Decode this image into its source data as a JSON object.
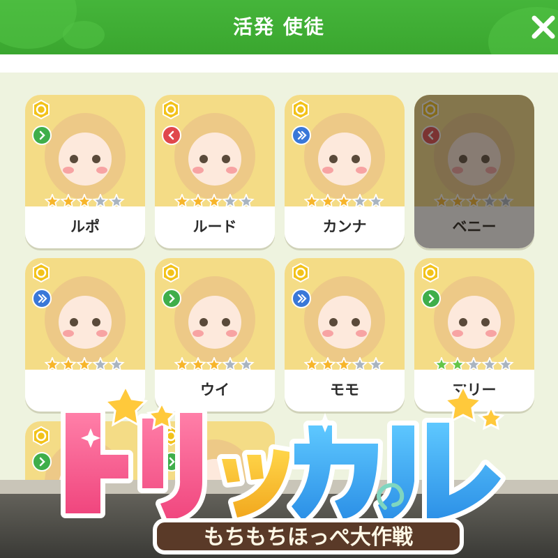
{
  "header": {
    "title": "活発 使徒",
    "close_icon": "close-icon",
    "bg_color": "#3fae34"
  },
  "characters": [
    {
      "name": "ルポ",
      "stars": 3,
      "max_stars": 5,
      "star_color": "gold",
      "direction": "forward",
      "direction_color": "#3fae4a",
      "dimmed": false
    },
    {
      "name": "ルード",
      "stars": 3,
      "max_stars": 5,
      "star_color": "gold",
      "direction": "back",
      "direction_color": "#e0474c",
      "dimmed": false
    },
    {
      "name": "カンナ",
      "stars": 3,
      "max_stars": 5,
      "star_color": "gold",
      "direction": "double",
      "direction_color": "#3a78d8",
      "dimmed": false
    },
    {
      "name": "ベニー",
      "stars": 3,
      "max_stars": 5,
      "star_color": "gold",
      "direction": "back",
      "direction_color": "#e0474c",
      "dimmed": true
    },
    {
      "name": "",
      "stars": 3,
      "max_stars": 5,
      "star_color": "gold",
      "direction": "double",
      "direction_color": "#3a78d8",
      "dimmed": false
    },
    {
      "name": "ウイ",
      "stars": 3,
      "max_stars": 5,
      "star_color": "gold",
      "direction": "forward",
      "direction_color": "#3fae4a",
      "dimmed": false
    },
    {
      "name": "モモ",
      "stars": 3,
      "max_stars": 5,
      "star_color": "gold",
      "direction": "double",
      "direction_color": "#3a78d8",
      "dimmed": false
    },
    {
      "name": "マリー",
      "stars": 2,
      "max_stars": 5,
      "star_color": "green",
      "direction": "forward",
      "direction_color": "#3fae4a",
      "dimmed": false
    },
    {
      "name": "",
      "stars": 0,
      "max_stars": 5,
      "star_color": "gold",
      "direction": "forward",
      "direction_color": "#3fae4a",
      "dimmed": false
    },
    {
      "name": "",
      "stars": 0,
      "max_stars": 5,
      "star_color": "gold",
      "direction": "forward",
      "direction_color": "#3fae4a",
      "dimmed": false
    }
  ],
  "logo": {
    "title": "ドリッカル",
    "subtitle": "もちもちほっぺ大作戦"
  }
}
